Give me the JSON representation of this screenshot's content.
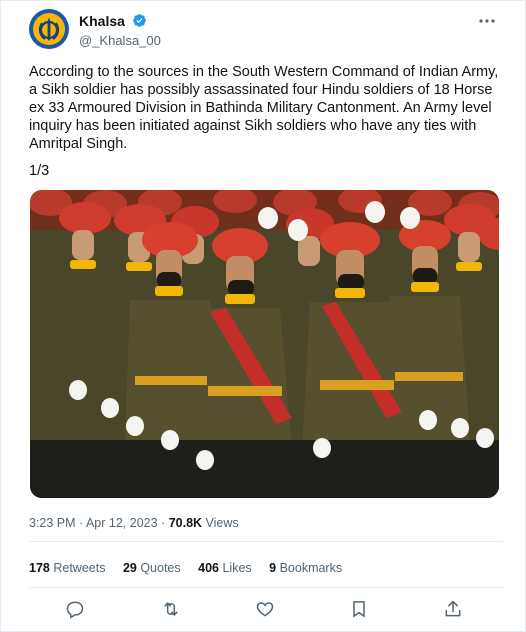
{
  "author": {
    "display_name": "Khalsa",
    "handle": "@_Khalsa_00",
    "verified": true,
    "avatar_icon": "khanda-emblem-icon"
  },
  "tweet": {
    "text": "According to the sources in the South Western Command of Indian Army, a Sikh soldier has possibly assassinated four Hindu soldiers of 18 Horse ex 33 Armoured Division in Bathinda Military Cantonment. An Army level inquiry has been initiated against Sikh soldiers who have any ties with Amritpal Singh.",
    "thread_count": "1/3",
    "image_icon": "soldiers-marching-photo"
  },
  "meta": {
    "timestamp": "3:23 PM · Apr 12, 2023 ·",
    "views_count": "70.8K",
    "views_label": "Views"
  },
  "stats": [
    {
      "count": "178",
      "label": "Retweets"
    },
    {
      "count": "29",
      "label": "Quotes"
    },
    {
      "count": "406",
      "label": "Likes"
    },
    {
      "count": "9",
      "label": "Bookmarks"
    }
  ],
  "actions": [
    "reply-icon",
    "retweet-icon",
    "like-icon",
    "bookmark-icon",
    "share-icon"
  ],
  "colors": {
    "text_primary": "#0f1419",
    "text_secondary": "#536471",
    "verified_blue": "#1d9bf0",
    "divider": "#e6ecf0",
    "turban_red": "#c8322a",
    "uniform_olive": "#4e4a2c"
  }
}
